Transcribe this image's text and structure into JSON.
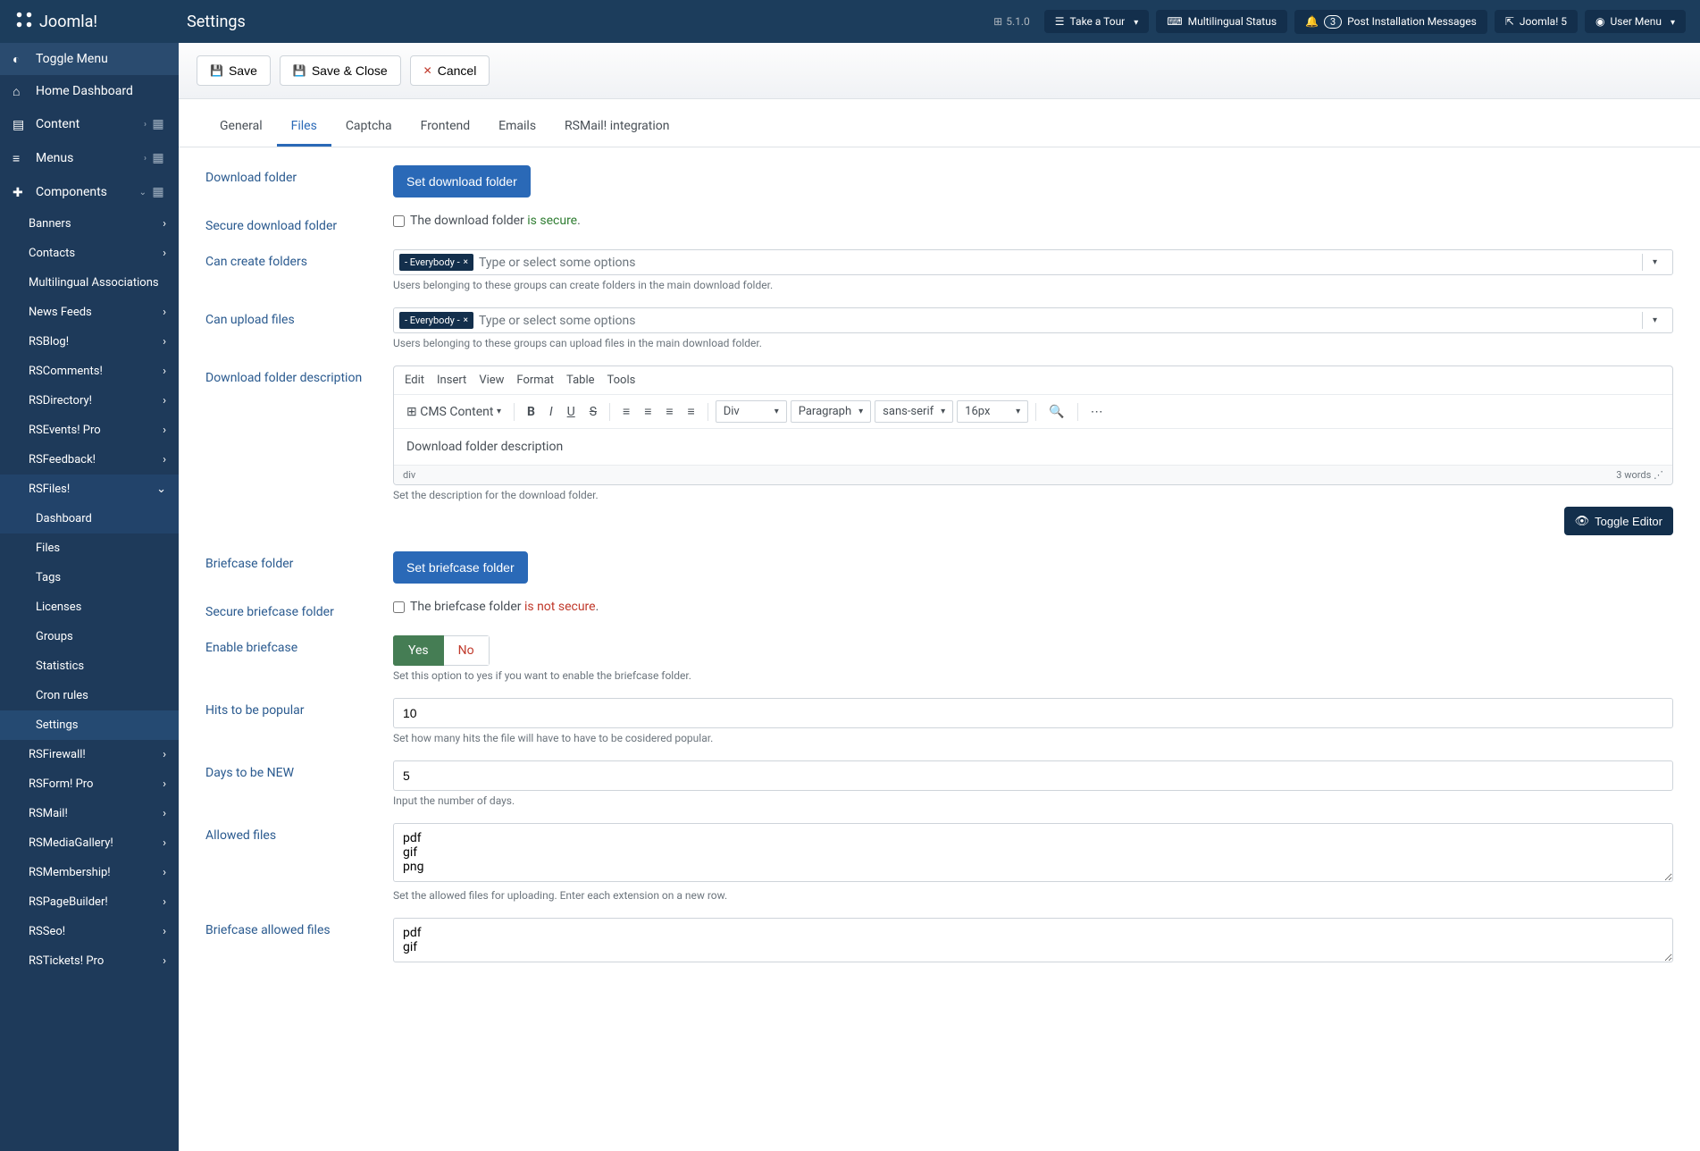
{
  "brand": "Joomla!",
  "page_title": "Settings",
  "version": "5.1.0",
  "topbar": {
    "tour": "Take a Tour",
    "multilingual": "Multilingual Status",
    "noti_count": "3",
    "post_install": "Post Installation Messages",
    "site": "Joomla! 5",
    "user": "User Menu"
  },
  "sidebar": {
    "toggle": "Toggle Menu",
    "home": "Home Dashboard",
    "content": "Content",
    "menus": "Menus",
    "components": "Components",
    "comp_items": [
      "Banners",
      "Contacts",
      "Multilingual Associations",
      "News Feeds",
      "RSBlog!",
      "RSComments!",
      "RSDirectory!",
      "RSEvents! Pro",
      "RSFeedback!",
      "RSFiles!",
      "RSFirewall!",
      "RSForm! Pro",
      "RSMail!",
      "RSMediaGallery!",
      "RSMembership!",
      "RSPageBuilder!",
      "RSSeo!",
      "RSTickets! Pro"
    ],
    "rsfiles_sub": [
      "Dashboard",
      "Files",
      "Tags",
      "Licenses",
      "Groups",
      "Statistics",
      "Cron rules",
      "Settings"
    ]
  },
  "actions": {
    "save": "Save",
    "save_close": "Save & Close",
    "cancel": "Cancel"
  },
  "tabs": [
    "General",
    "Files",
    "Captcha",
    "Frontend",
    "Emails",
    "RSMail! integration"
  ],
  "form": {
    "download_folder_label": "Download folder",
    "set_download_btn": "Set download folder",
    "secure_download_label": "Secure download folder",
    "secure_download_text1": "The download folder ",
    "secure_download_text2": "is secure",
    "can_create_label": "Can create folders",
    "everybody_chip": "- Everybody -",
    "ms_placeholder": "Type or select some options",
    "can_create_help": "Users belonging to these groups can create folders in the main download folder.",
    "can_upload_label": "Can upload files",
    "can_upload_help": "Users belonging to these groups can upload files in the main download folder.",
    "dfd_label": "Download folder description",
    "editor_menu": [
      "Edit",
      "Insert",
      "View",
      "Format",
      "Table",
      "Tools"
    ],
    "editor_cms": "CMS Content",
    "editor_block": "Div",
    "editor_para": "Paragraph",
    "editor_font": "sans-serif",
    "editor_size": "16px",
    "editor_content": "Download folder description",
    "editor_path": "div",
    "editor_words": "3 words",
    "dfd_help": "Set the description for the download folder.",
    "toggle_editor": "Toggle Editor",
    "briefcase_label": "Briefcase folder",
    "set_briefcase_btn": "Set briefcase folder",
    "secure_briefcase_label": "Secure briefcase folder",
    "secure_briefcase_text1": "The briefcase folder ",
    "secure_briefcase_text2": "is not secure",
    "enable_briefcase_label": "Enable briefcase",
    "yes": "Yes",
    "no": "No",
    "enable_briefcase_help": "Set this option to yes if you want to enable the briefcase folder.",
    "hits_label": "Hits to be popular",
    "hits_value": "10",
    "hits_help": "Set how many hits the file will have to have to be cosidered popular.",
    "days_label": "Days to be NEW",
    "days_value": "5",
    "days_help": "Input the number of days.",
    "allowed_label": "Allowed files",
    "allowed_value": "pdf\ngif\npng",
    "allowed_help": "Set the allowed files for uploading. Enter each extension on a new row.",
    "briefcase_allowed_label": "Briefcase allowed files",
    "briefcase_allowed_value": "pdf\ngif"
  }
}
